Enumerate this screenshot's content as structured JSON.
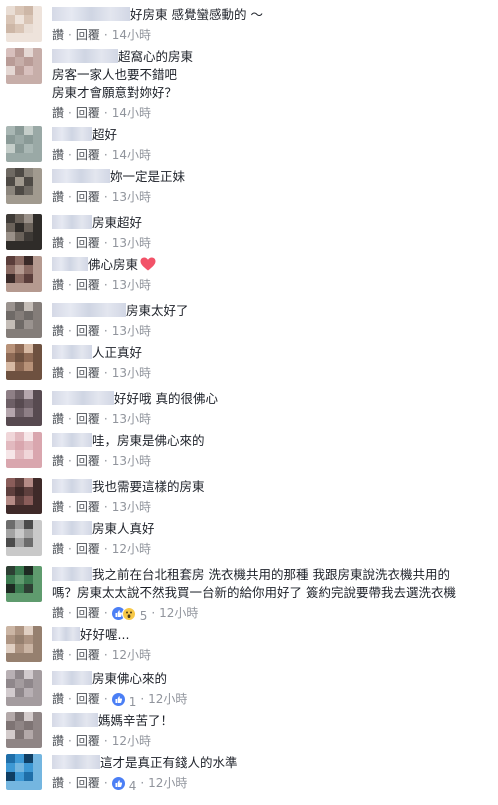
{
  "actions": {
    "like": "讚",
    "reply": "回覆",
    "separator": "·"
  },
  "comments": [
    {
      "lines": [
        "好房東 感覺蠻感動的 ～"
      ],
      "time": "14小時",
      "avatar": [
        "#e9ddd4",
        "#d9c5b6",
        "#cdb7a7",
        "#eee3db"
      ]
    },
    {
      "lines": [
        "超窩心的房東",
        "房客一家人也要不錯吧",
        "房東才會願意對妳好？"
      ],
      "time": "14小時",
      "avatar": [
        "#d8c0bd",
        "#b99c97",
        "#e5d8d4",
        "#c7aea9"
      ]
    },
    {
      "lines": [
        "超好"
      ],
      "time": "14小時",
      "avatar": [
        "#a9b7b4",
        "#8a9a97",
        "#c5ceca",
        "#9aa9a6"
      ]
    },
    {
      "lines": [
        "妳一定是正妹"
      ],
      "time": "13小時",
      "avatar": [
        "#6f6a63",
        "#4e4a45",
        "#8b857c",
        "#a19a8f"
      ]
    },
    {
      "lines": [
        "房東超好"
      ],
      "time": "13小時",
      "avatar": [
        "#3e3a36",
        "#6a625a",
        "#9a9189",
        "#2f2c29"
      ]
    },
    {
      "lines": [
        "佛心房東"
      ],
      "time": "13小時",
      "heart": true,
      "avatar": [
        "#5a3d3a",
        "#8a6a62",
        "#3a2a28",
        "#b59a90"
      ]
    },
    {
      "lines": [
        "房東太好了"
      ],
      "time": "13小時",
      "avatar": [
        "#9a938f",
        "#6f6a67",
        "#c4bdb7",
        "#847d79"
      ]
    },
    {
      "lines": [
        "人正真好"
      ],
      "time": "13小時",
      "avatar": [
        "#b89279",
        "#8e6a55",
        "#d7b9a3",
        "#6e5140"
      ]
    },
    {
      "lines": [
        "好好哦 真的很佛心"
      ],
      "time": "13小時",
      "avatar": [
        "#8e7f86",
        "#6d5f66",
        "#b5a6ad",
        "#574a50"
      ]
    },
    {
      "lines": [
        "哇，房東是佛心來的"
      ],
      "time": "13小時",
      "avatar": [
        "#f0d6d9",
        "#e2b9bf",
        "#f6e6e8",
        "#d9a6ae"
      ]
    },
    {
      "lines": [
        "我也需要這樣的房東"
      ],
      "time": "13小時",
      "avatar": [
        "#8a5d5a",
        "#5e3f3d",
        "#b58b86",
        "#3f2a29"
      ]
    },
    {
      "lines": [
        "房東人真好"
      ],
      "time": "12小時",
      "avatar": [
        "#6c6c6c",
        "#a3a3a3",
        "#4b4b4b",
        "#c9c9c9"
      ]
    },
    {
      "lines": [
        "我之前在台北租套房 洗衣機共用的那種 我跟房東說洗衣機共用的",
        "嗎？房東太太說不然我買一台新的給你用好了 簽約完說要帶我去選洗衣機"
      ],
      "time": "12小時",
      "reactions": "5",
      "avatar": [
        "#2d3f33",
        "#3b7a4f",
        "#1e2a22",
        "#5f9b6e"
      ]
    },
    {
      "lines": [
        "好好喔..."
      ],
      "time": "12小時",
      "avatar": [
        "#cbb5a4",
        "#ad9482",
        "#e0cfc2",
        "#96806f"
      ]
    },
    {
      "lines": [
        "房東佛心來的"
      ],
      "time": "12小時",
      "reactions": "1",
      "reaction_style": "like",
      "avatar": [
        "#b8b0b4",
        "#8f878b",
        "#d2cbce",
        "#a49c9f"
      ]
    },
    {
      "lines": [
        "媽媽辛苦了！"
      ],
      "time": "12小時",
      "avatar": [
        "#b3a9a9",
        "#7e7474",
        "#d3cbcb",
        "#8f8585"
      ]
    },
    {
      "lines": [
        "這才是真正有錢人的水準"
      ],
      "time": "12小時",
      "reactions": "4",
      "reaction_style": "like",
      "avatar": [
        "#1f6ea8",
        "#3d98d4",
        "#0f3e63",
        "#74b6e0"
      ]
    }
  ]
}
